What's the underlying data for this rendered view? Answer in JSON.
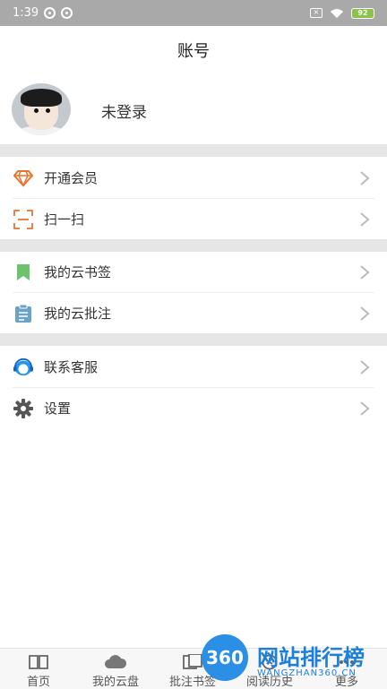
{
  "status_bar": {
    "time": "1:39",
    "battery": "92"
  },
  "header": {
    "title": "账号"
  },
  "profile": {
    "login_status": "未登录"
  },
  "menu": {
    "vip": "开通会员",
    "scan": "扫一扫",
    "bookmarks": "我的云书签",
    "annotations": "我的云批注",
    "support": "联系客服",
    "settings": "设置"
  },
  "tabs": [
    "首页",
    "我的云盘",
    "批注书签",
    "阅读历史",
    "更多"
  ],
  "watermark": {
    "badge": "360",
    "title": "网站排行榜",
    "sub": "WANGZHAN360.CN"
  },
  "colors": {
    "vip_icon": "#e8742c",
    "scan_icon": "#e8742c",
    "bookmark_icon": "#6cc36c",
    "annotation_icon": "#6aa3c6",
    "support_icon": "#2196f3",
    "settings_icon": "#555555"
  }
}
